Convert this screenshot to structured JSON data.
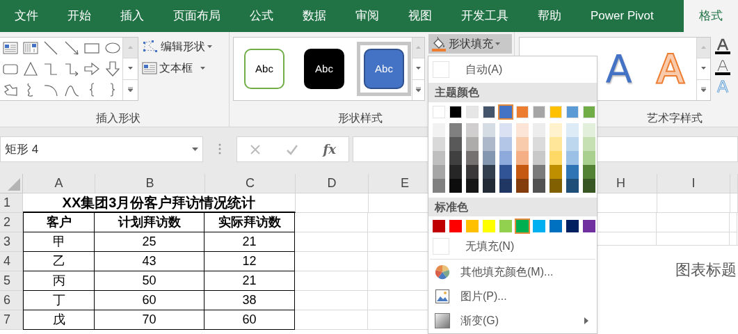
{
  "menu_tabs": [
    {
      "label": "文件",
      "selected": false
    },
    {
      "label": "开始",
      "selected": false
    },
    {
      "label": "插入",
      "selected": false
    },
    {
      "label": "页面布局",
      "selected": false
    },
    {
      "label": "公式",
      "selected": false
    },
    {
      "label": "数据",
      "selected": false
    },
    {
      "label": "审阅",
      "selected": false
    },
    {
      "label": "视图",
      "selected": false
    },
    {
      "label": "开发工具",
      "selected": false
    },
    {
      "label": "帮助",
      "selected": false
    },
    {
      "label": "Power Pivot",
      "selected": false
    },
    {
      "label": "格式",
      "selected": true
    }
  ],
  "ribbon": {
    "insert_shapes": {
      "edit_shape": "编辑形状",
      "text_box": "文本框",
      "group_label": "插入形状"
    },
    "shape_styles": {
      "samples": [
        {
          "text": "Abc",
          "kind": "outline",
          "selected": false
        },
        {
          "text": "Abc",
          "kind": "dark",
          "selected": false
        },
        {
          "text": "Abc",
          "kind": "blue",
          "selected": true
        }
      ],
      "shape_fill": "形状填充",
      "group_label": "形状样式"
    },
    "wordart_styles": {
      "samples": [
        {
          "text": "A",
          "kind": "blue-fill"
        },
        {
          "text": "A",
          "kind": "orange-outline"
        }
      ],
      "group_label": "艺术字样式"
    }
  },
  "formula_bar": {
    "name_box": "矩形 4",
    "fx": "fx"
  },
  "sheet": {
    "columns": [
      "A",
      "B",
      "C",
      "D",
      "E",
      "H",
      "I"
    ],
    "rows": [
      {
        "header": "1",
        "kind": "title",
        "cells": [
          "XX集团3月份客户拜访情况统计"
        ]
      },
      {
        "header": "2",
        "kind": "header",
        "cells": [
          "客户",
          "计划拜访数",
          "实际拜访数"
        ]
      },
      {
        "header": "3",
        "kind": "data",
        "cells": [
          "甲",
          "25",
          "21"
        ]
      },
      {
        "header": "4",
        "kind": "data",
        "cells": [
          "乙",
          "43",
          "12"
        ]
      },
      {
        "header": "5",
        "kind": "data",
        "cells": [
          "丙",
          "50",
          "21"
        ]
      },
      {
        "header": "6",
        "kind": "data",
        "cells": [
          "丁",
          "60",
          "38"
        ]
      },
      {
        "header": "7",
        "kind": "data",
        "cells": [
          "戊",
          "70",
          "60"
        ]
      }
    ]
  },
  "chart": {
    "title": "图表标题"
  },
  "fill_menu": {
    "automatic": "自动(A)",
    "theme_heading": "主题颜色",
    "theme_colors": [
      {
        "color": "#ffffff",
        "selected": false,
        "shades": [
          {
            "color": "#f2f2f2"
          },
          {
            "color": "#d9d9d9"
          },
          {
            "color": "#bfbfbf"
          },
          {
            "color": "#a6a6a6"
          },
          {
            "color": "#808080"
          }
        ]
      },
      {
        "color": "#000000",
        "selected": false,
        "shades": [
          {
            "color": "#808080"
          },
          {
            "color": "#595959"
          },
          {
            "color": "#404040"
          },
          {
            "color": "#262626"
          },
          {
            "color": "#0d0d0d"
          }
        ]
      },
      {
        "color": "#e7e6e6",
        "selected": false,
        "shades": [
          {
            "color": "#d0cece"
          },
          {
            "color": "#aeabab"
          },
          {
            "color": "#757171"
          },
          {
            "color": "#3a3838"
          },
          {
            "color": "#161616"
          }
        ]
      },
      {
        "color": "#44546a",
        "selected": false,
        "shades": [
          {
            "color": "#d6dce4"
          },
          {
            "color": "#adb9ca"
          },
          {
            "color": "#8497b0"
          },
          {
            "color": "#333f4f"
          },
          {
            "color": "#222b35"
          }
        ]
      },
      {
        "color": "#4472c4",
        "selected": true,
        "shades": [
          {
            "color": "#d9e1f2"
          },
          {
            "color": "#b4c6e7"
          },
          {
            "color": "#8ea9db"
          },
          {
            "color": "#305496"
          },
          {
            "color": "#203764"
          }
        ]
      },
      {
        "color": "#ed7d31",
        "selected": false,
        "shades": [
          {
            "color": "#fce4d6"
          },
          {
            "color": "#f8cbad"
          },
          {
            "color": "#f4b084"
          },
          {
            "color": "#c65911"
          },
          {
            "color": "#833c0c"
          }
        ]
      },
      {
        "color": "#a5a5a5",
        "selected": false,
        "shades": [
          {
            "color": "#ededed"
          },
          {
            "color": "#dbdbdb"
          },
          {
            "color": "#c9c9c9"
          },
          {
            "color": "#7b7b7b"
          },
          {
            "color": "#525252"
          }
        ]
      },
      {
        "color": "#ffc000",
        "selected": false,
        "shades": [
          {
            "color": "#fff2cc"
          },
          {
            "color": "#ffe699"
          },
          {
            "color": "#ffd966"
          },
          {
            "color": "#bf8f00"
          },
          {
            "color": "#806000"
          }
        ]
      },
      {
        "color": "#5b9bd5",
        "selected": false,
        "shades": [
          {
            "color": "#ddebf7"
          },
          {
            "color": "#bdd7ee"
          },
          {
            "color": "#9bc2e6"
          },
          {
            "color": "#2f75b5"
          },
          {
            "color": "#1f4e78"
          }
        ]
      },
      {
        "color": "#70ad47",
        "selected": false,
        "shades": [
          {
            "color": "#e2efda"
          },
          {
            "color": "#c6e0b4"
          },
          {
            "color": "#a9d08e"
          },
          {
            "color": "#548235"
          },
          {
            "color": "#375623"
          }
        ]
      }
    ],
    "standard_heading": "标准色",
    "standard_colors": [
      {
        "color": "#c00000",
        "selected": false
      },
      {
        "color": "#ff0000",
        "selected": false
      },
      {
        "color": "#ffc000",
        "selected": false
      },
      {
        "color": "#ffff00",
        "selected": false
      },
      {
        "color": "#92d050",
        "selected": false
      },
      {
        "color": "#00b050",
        "selected": true
      },
      {
        "color": "#00b0f0",
        "selected": false
      },
      {
        "color": "#0070c0",
        "selected": false
      },
      {
        "color": "#002060",
        "selected": false
      },
      {
        "color": "#7030a0",
        "selected": false
      }
    ],
    "no_fill": "无填充(N)",
    "items": [
      {
        "label": "其他填充颜色(M)...",
        "kind": "colors",
        "submenu": false
      },
      {
        "label": "图片(P)...",
        "kind": "picture",
        "submenu": false
      },
      {
        "label": "渐变(G)",
        "kind": "gradient",
        "submenu": true
      }
    ]
  }
}
